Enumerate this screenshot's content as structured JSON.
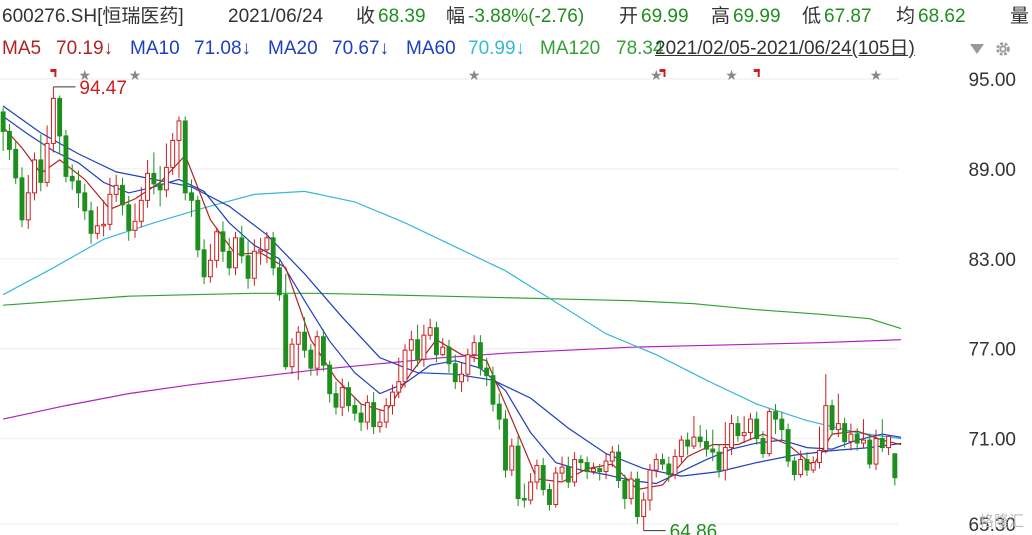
{
  "header": {
    "symbol": "600276.SH[恒瑞医药]",
    "date": "2021/06/24",
    "close_label": "收",
    "close": "68.39",
    "change_label": "幅",
    "change": "-3.88%(-2.76)",
    "open_label": "开",
    "open": "69.99",
    "high_label": "高",
    "high": "69.99",
    "low_label": "低",
    "low": "67.87",
    "avg_label": "均",
    "avg": "68.62",
    "vol_label": "量"
  },
  "ma_bar": {
    "ma5": "MA5",
    "ma5_value": "70.19↓",
    "ma10": "MA10",
    "ma10_value": "71.08↓",
    "ma20": "MA20",
    "ma20_value": "70.67↓",
    "ma60": "MA60",
    "ma60_value": "70.99↓",
    "ma120": "MA120",
    "ma120_value": "78.34",
    "range": "2021/02/05-2021/06/24(105日)"
  },
  "colors": {
    "up": "#cc1f1f",
    "down": "#1e8f1e",
    "ma5": "#b22222",
    "ma10": "#1e3fbf",
    "ma20": "#38b8d8",
    "ma60": "#34a034",
    "ma120": "#b020c0"
  },
  "chart_data": {
    "type": "candlestick",
    "y_ticks": [
      "95.00",
      "89.00",
      "83.00",
      "77.00",
      "71.00",
      "65.30"
    ],
    "ylim": [
      65.3,
      96.0
    ],
    "annotations": {
      "high": "94.47",
      "low": "64.86"
    },
    "candles": [
      [
        92.8,
        91.5,
        93.1,
        90.2
      ],
      [
        91.5,
        90.3,
        92.0,
        89.6
      ],
      [
        90.3,
        88.4,
        90.9,
        88.0
      ],
      [
        88.4,
        85.6,
        89.1,
        85.1
      ],
      [
        85.6,
        87.4,
        88.6,
        85.0
      ],
      [
        87.4,
        89.6,
        90.1,
        86.9
      ],
      [
        89.6,
        88.1,
        91.3,
        87.5
      ],
      [
        88.1,
        90.7,
        91.9,
        87.8
      ],
      [
        90.7,
        93.7,
        94.47,
        90.1
      ],
      [
        93.7,
        91.2,
        93.9,
        90.0
      ],
      [
        91.2,
        88.5,
        91.6,
        88.1
      ],
      [
        88.5,
        88.2,
        89.3,
        87.6
      ],
      [
        88.2,
        87.4,
        88.9,
        86.4
      ],
      [
        87.4,
        86.2,
        88.0,
        85.6
      ],
      [
        86.2,
        84.7,
        86.8,
        84.0
      ],
      [
        84.7,
        85.2,
        86.5,
        84.3
      ],
      [
        85.2,
        85.3,
        86.9,
        84.5
      ],
      [
        85.3,
        87.3,
        88.4,
        84.9
      ],
      [
        87.3,
        87.9,
        88.6,
        86.8
      ],
      [
        87.9,
        86.6,
        88.4,
        85.9
      ],
      [
        86.6,
        84.9,
        87.2,
        84.2
      ],
      [
        84.9,
        85.5,
        86.7,
        84.4
      ],
      [
        85.5,
        86.9,
        87.8,
        85.1
      ],
      [
        86.9,
        88.7,
        89.6,
        86.4
      ],
      [
        88.7,
        88.0,
        90.1,
        87.3
      ],
      [
        88.0,
        87.6,
        89.2,
        86.5
      ],
      [
        87.6,
        89.1,
        90.7,
        87.1
      ],
      [
        89.1,
        90.9,
        91.4,
        88.6
      ],
      [
        90.9,
        92.2,
        92.5,
        88.4
      ],
      [
        92.2,
        87.4,
        92.5,
        86.9
      ],
      [
        87.4,
        86.9,
        88.3,
        85.8
      ],
      [
        86.9,
        83.6,
        87.2,
        83.1
      ],
      [
        83.6,
        81.8,
        84.3,
        81.3
      ],
      [
        81.8,
        82.9,
        84.0,
        81.4
      ],
      [
        82.9,
        84.8,
        85.1,
        82.4
      ],
      [
        84.8,
        83.5,
        85.5,
        82.8
      ],
      [
        83.5,
        82.4,
        84.4,
        81.9
      ],
      [
        82.4,
        84.4,
        84.8,
        81.9
      ],
      [
        84.4,
        83.2,
        85.2,
        82.7
      ],
      [
        83.2,
        81.7,
        84.2,
        81.0
      ],
      [
        81.7,
        83.5,
        84.3,
        81.2
      ],
      [
        83.5,
        83.6,
        84.4,
        82.6
      ],
      [
        83.6,
        84.4,
        84.8,
        82.7
      ],
      [
        84.4,
        82.4,
        84.8,
        81.9
      ],
      [
        82.4,
        80.6,
        83.0,
        80.2
      ],
      [
        80.6,
        75.8,
        82.0,
        75.6
      ],
      [
        75.8,
        77.3,
        77.7,
        75.3
      ],
      [
        77.3,
        78.1,
        78.5,
        74.9
      ],
      [
        78.1,
        76.9,
        79.1,
        76.4
      ],
      [
        76.9,
        75.7,
        77.3,
        75.2
      ],
      [
        75.7,
        77.8,
        78.2,
        75.2
      ],
      [
        77.8,
        75.9,
        78.3,
        75.5
      ],
      [
        75.9,
        74.0,
        76.2,
        73.4
      ],
      [
        74.0,
        73.1,
        74.8,
        72.6
      ],
      [
        73.1,
        74.4,
        75.0,
        72.5
      ],
      [
        74.4,
        73.2,
        74.8,
        72.8
      ],
      [
        73.2,
        72.7,
        73.8,
        72.2
      ],
      [
        72.7,
        72.1,
        73.3,
        71.5
      ],
      [
        72.1,
        73.4,
        73.9,
        71.6
      ],
      [
        73.4,
        71.8,
        74.1,
        71.3
      ],
      [
        71.8,
        72.1,
        72.9,
        71.4
      ],
      [
        72.1,
        73.2,
        73.7,
        71.7
      ],
      [
        73.2,
        74.1,
        74.6,
        72.6
      ],
      [
        74.1,
        74.8,
        76.4,
        73.7
      ],
      [
        74.8,
        76.9,
        77.3,
        74.4
      ],
      [
        76.9,
        77.6,
        78.2,
        75.6
      ],
      [
        77.6,
        76.3,
        78.6,
        75.8
      ],
      [
        76.3,
        77.9,
        78.6,
        75.8
      ],
      [
        77.9,
        78.4,
        79.0,
        77.6
      ],
      [
        78.4,
        76.6,
        78.8,
        76.1
      ],
      [
        76.6,
        77.1,
        77.7,
        76.5
      ],
      [
        77.1,
        76.0,
        77.6,
        75.4
      ],
      [
        76.0,
        74.8,
        76.6,
        74.3
      ],
      [
        74.8,
        75.3,
        76.1,
        74.1
      ],
      [
        75.3,
        76.6,
        77.0,
        74.8
      ],
      [
        76.6,
        77.4,
        77.9,
        76.1
      ],
      [
        77.4,
        75.7,
        77.9,
        75.2
      ],
      [
        75.7,
        75.2,
        76.4,
        74.5
      ],
      [
        75.2,
        73.3,
        75.8,
        72.8
      ],
      [
        73.3,
        72.3,
        74.0,
        71.6
      ],
      [
        72.3,
        68.9,
        72.9,
        68.4
      ],
      [
        68.9,
        70.5,
        71.0,
        68.5
      ],
      [
        70.5,
        67.0,
        71.2,
        66.5
      ],
      [
        67.0,
        66.9,
        68.0,
        66.4
      ],
      [
        66.9,
        68.1,
        68.7,
        66.6
      ],
      [
        68.1,
        69.2,
        69.6,
        67.6
      ],
      [
        69.2,
        67.6,
        69.7,
        67.2
      ],
      [
        67.6,
        66.6,
        68.0,
        66.2
      ],
      [
        66.6,
        68.7,
        69.1,
        66.4
      ],
      [
        68.7,
        69.1,
        69.8,
        68.2
      ],
      [
        69.1,
        68.1,
        69.8,
        67.7
      ],
      [
        68.1,
        69.6,
        70.1,
        67.8
      ],
      [
        69.6,
        69.4,
        69.9,
        68.8
      ],
      [
        69.4,
        68.8,
        69.8,
        68.3
      ],
      [
        68.8,
        69.0,
        69.4,
        68.6
      ],
      [
        69.0,
        68.8,
        69.3,
        68.2
      ],
      [
        68.8,
        69.5,
        70.0,
        68.3
      ],
      [
        69.5,
        70.1,
        70.5,
        69.1
      ],
      [
        70.1,
        68.2,
        70.6,
        67.7
      ],
      [
        68.2,
        67.0,
        68.6,
        66.3
      ],
      [
        67.0,
        68.3,
        68.8,
        66.6
      ],
      [
        68.3,
        65.8,
        68.8,
        65.3
      ],
      [
        65.8,
        66.9,
        67.4,
        64.86
      ],
      [
        66.9,
        68.9,
        69.3,
        66.2
      ],
      [
        68.9,
        69.6,
        70.0,
        68.4
      ],
      [
        69.6,
        69.3,
        70.0,
        68.9
      ],
      [
        69.3,
        68.6,
        69.8,
        68.1
      ],
      [
        68.6,
        69.8,
        70.3,
        68.3
      ],
      [
        69.8,
        70.9,
        71.2,
        69.4
      ],
      [
        70.9,
        70.5,
        71.4,
        69.9
      ],
      [
        70.5,
        71.1,
        72.5,
        70.3
      ],
      [
        71.1,
        70.8,
        71.9,
        70.4
      ],
      [
        70.8,
        70.3,
        71.6,
        69.8
      ],
      [
        70.3,
        70.1,
        71.6,
        69.5
      ],
      [
        70.1,
        68.9,
        70.6,
        68.4
      ],
      [
        68.9,
        70.4,
        72.1,
        68.2
      ],
      [
        70.4,
        72.0,
        72.6,
        69.9
      ],
      [
        72.0,
        71.2,
        72.5,
        70.8
      ],
      [
        71.2,
        71.4,
        72.5,
        70.7
      ],
      [
        71.4,
        72.3,
        72.7,
        70.9
      ],
      [
        72.3,
        71.0,
        72.8,
        70.6
      ],
      [
        71.0,
        70.0,
        71.5,
        69.7
      ],
      [
        70.0,
        72.8,
        73.0,
        69.8
      ],
      [
        72.8,
        72.3,
        73.3,
        71.3
      ],
      [
        72.3,
        71.6,
        72.8,
        70.9
      ],
      [
        71.6,
        69.5,
        72.0,
        69.1
      ],
      [
        69.5,
        68.6,
        69.8,
        68.2
      ],
      [
        68.6,
        69.6,
        70.2,
        68.4
      ],
      [
        69.6,
        68.9,
        70.1,
        68.5
      ],
      [
        68.9,
        69.4,
        69.8,
        68.7
      ],
      [
        69.4,
        70.2,
        71.8,
        69.0
      ],
      [
        70.2,
        73.2,
        75.3,
        70.0
      ],
      [
        73.2,
        71.6,
        73.6,
        71.2
      ],
      [
        71.6,
        72.0,
        74.0,
        71.1
      ],
      [
        72.0,
        70.8,
        72.4,
        70.4
      ],
      [
        70.8,
        71.3,
        72.0,
        70.2
      ],
      [
        71.3,
        70.7,
        71.7,
        70.2
      ],
      [
        70.7,
        70.9,
        72.3,
        70.4
      ],
      [
        70.9,
        69.3,
        71.3,
        69.0
      ],
      [
        69.3,
        71.0,
        71.6,
        68.9
      ],
      [
        71.0,
        70.4,
        72.3,
        70.1
      ],
      [
        70.4,
        71.15,
        71.2,
        69.9
      ],
      [
        69.99,
        68.39,
        69.99,
        67.87
      ]
    ],
    "ma5": [
      [
        0,
        91.8
      ],
      [
        3,
        90.4
      ],
      [
        6,
        88.7
      ],
      [
        9,
        89.6
      ],
      [
        13,
        88.3
      ],
      [
        17,
        86.3
      ],
      [
        21,
        87.0
      ],
      [
        25,
        88.1
      ],
      [
        29,
        89.9
      ],
      [
        33,
        85.6
      ],
      [
        37,
        83.3
      ],
      [
        41,
        83.4
      ],
      [
        45,
        82.4
      ],
      [
        49,
        77.6
      ],
      [
        53,
        75.0
      ],
      [
        57,
        73.3
      ],
      [
        61,
        72.8
      ],
      [
        65,
        75.4
      ],
      [
        69,
        77.6
      ],
      [
        73,
        76.6
      ],
      [
        77,
        76.2
      ],
      [
        81,
        72.3
      ],
      [
        85,
        68.3
      ],
      [
        89,
        68.1
      ],
      [
        93,
        69.0
      ],
      [
        97,
        69.3
      ],
      [
        101,
        67.6
      ],
      [
        105,
        67.9
      ],
      [
        109,
        69.8
      ],
      [
        113,
        70.6
      ],
      [
        117,
        70.6
      ],
      [
        121,
        71.3
      ],
      [
        125,
        70.6
      ],
      [
        129,
        69.2
      ],
      [
        132,
        71.3
      ],
      [
        136,
        71.5
      ],
      [
        140,
        70.9
      ],
      [
        143,
        70.6
      ]
    ],
    "ma10": [
      [
        0,
        92.5
      ],
      [
        4,
        91.3
      ],
      [
        8,
        90.2
      ],
      [
        12,
        89.4
      ],
      [
        16,
        88.1
      ],
      [
        20,
        87.4
      ],
      [
        24,
        87.8
      ],
      [
        28,
        88.3
      ],
      [
        32,
        87.5
      ],
      [
        36,
        85.4
      ],
      [
        40,
        83.9
      ],
      [
        44,
        83.0
      ],
      [
        48,
        80.2
      ],
      [
        52,
        77.5
      ],
      [
        56,
        75.4
      ],
      [
        60,
        74.0
      ],
      [
        64,
        74.7
      ],
      [
        68,
        75.9
      ],
      [
        72,
        76.2
      ],
      [
        76,
        75.7
      ],
      [
        80,
        74.2
      ],
      [
        84,
        71.4
      ],
      [
        88,
        69.4
      ],
      [
        92,
        68.9
      ],
      [
        96,
        68.6
      ],
      [
        100,
        68.2
      ],
      [
        104,
        68.0
      ],
      [
        108,
        68.8
      ],
      [
        112,
        69.6
      ],
      [
        116,
        70.3
      ],
      [
        120,
        70.7
      ],
      [
        124,
        70.9
      ],
      [
        128,
        70.4
      ],
      [
        132,
        70.3
      ],
      [
        136,
        70.9
      ],
      [
        140,
        71.3
      ],
      [
        143,
        71.08
      ]
    ],
    "ma20": [
      [
        0,
        93.2
      ],
      [
        6,
        91.4
      ],
      [
        12,
        90.0
      ],
      [
        18,
        88.8
      ],
      [
        24,
        88.3
      ],
      [
        30,
        87.8
      ],
      [
        36,
        86.5
      ],
      [
        42,
        84.6
      ],
      [
        48,
        82.0
      ],
      [
        54,
        79.1
      ],
      [
        60,
        76.4
      ],
      [
        66,
        75.4
      ],
      [
        72,
        75.3
      ],
      [
        78,
        74.9
      ],
      [
        84,
        73.7
      ],
      [
        90,
        71.7
      ],
      [
        96,
        70.0
      ],
      [
        102,
        69.0
      ],
      [
        108,
        68.5
      ],
      [
        114,
        68.8
      ],
      [
        120,
        69.4
      ],
      [
        126,
        69.9
      ],
      [
        132,
        70.2
      ],
      [
        138,
        70.4
      ],
      [
        143,
        70.67
      ]
    ],
    "ma60": [
      [
        0,
        80.6
      ],
      [
        8,
        82.4
      ],
      [
        16,
        84.3
      ],
      [
        24,
        85.4
      ],
      [
        32,
        86.4
      ],
      [
        40,
        87.3
      ],
      [
        48,
        87.5
      ],
      [
        56,
        86.8
      ],
      [
        64,
        85.4
      ],
      [
        72,
        83.8
      ],
      [
        80,
        82.2
      ],
      [
        88,
        80.1
      ],
      [
        96,
        78.0
      ],
      [
        104,
        76.6
      ],
      [
        112,
        74.9
      ],
      [
        120,
        73.3
      ],
      [
        128,
        72.2
      ],
      [
        136,
        71.4
      ],
      [
        143,
        70.99
      ]
    ],
    "ma120": [
      [
        0,
        79.9
      ],
      [
        10,
        80.2
      ],
      [
        20,
        80.5
      ],
      [
        30,
        80.6
      ],
      [
        40,
        80.7
      ],
      [
        50,
        80.7
      ],
      [
        60,
        80.6
      ],
      [
        70,
        80.5
      ],
      [
        80,
        80.4
      ],
      [
        90,
        80.3
      ],
      [
        100,
        80.2
      ],
      [
        110,
        80.0
      ],
      [
        120,
        79.6
      ],
      [
        130,
        79.3
      ],
      [
        138,
        79.0
      ],
      [
        143,
        78.34
      ]
    ],
    "ma_lower": [
      [
        0,
        72.3
      ],
      [
        10,
        73.2
      ],
      [
        20,
        74.0
      ],
      [
        30,
        74.6
      ],
      [
        40,
        75.1
      ],
      [
        50,
        75.6
      ],
      [
        60,
        76.0
      ],
      [
        70,
        76.4
      ],
      [
        80,
        76.7
      ],
      [
        90,
        76.9
      ],
      [
        100,
        77.1
      ],
      [
        110,
        77.2
      ],
      [
        120,
        77.3
      ],
      [
        130,
        77.4
      ],
      [
        143,
        77.6
      ]
    ],
    "markers": [
      {
        "i": 8,
        "type": "flag"
      },
      {
        "i": 13,
        "type": "star"
      },
      {
        "i": 21,
        "type": "star"
      },
      {
        "i": 75,
        "type": "star"
      },
      {
        "i": 104,
        "type": "star"
      },
      {
        "i": 105,
        "type": "flag"
      },
      {
        "i": 116,
        "type": "star"
      },
      {
        "i": 120,
        "type": "flag"
      },
      {
        "i": 139,
        "type": "star"
      }
    ]
  }
}
